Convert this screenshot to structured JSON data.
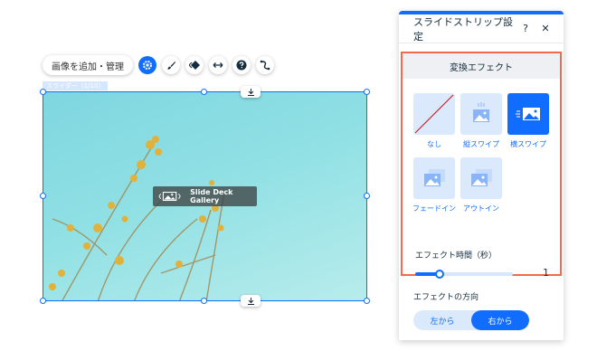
{
  "toolbar": {
    "add_manage_label": "画像を追加・管理",
    "icons": [
      "gear-icon",
      "brush-icon",
      "animation-icon",
      "stretch-icon",
      "help-icon",
      "connect-icon"
    ]
  },
  "canvas": {
    "slider_tag": "スライダー（1/10）",
    "gallery_label": "Slide Deck Gallery"
  },
  "panel": {
    "title": "スライドストリップ設定",
    "help_label": "?",
    "close_label": "✕",
    "effect_section_title": "変換エフェクト",
    "effects": [
      {
        "label": "なし",
        "selected": false
      },
      {
        "label": "縦スワイプ",
        "selected": false
      },
      {
        "label": "横スワイプ",
        "selected": true
      },
      {
        "label": "フェードイン",
        "selected": false
      },
      {
        "label": "アウトイン",
        "selected": false
      }
    ],
    "duration_label": "エフェクト時間（秒）",
    "duration_value": "1",
    "duration_fraction": 0.25,
    "direction_label": "エフェクトの方向",
    "direction_options": [
      {
        "label": "左から",
        "selected": false
      },
      {
        "label": "右から",
        "selected": true
      }
    ]
  },
  "colors": {
    "accent": "#116dff",
    "highlight_border": "#f36a4c",
    "tile_bg": "#dbe9fd"
  }
}
